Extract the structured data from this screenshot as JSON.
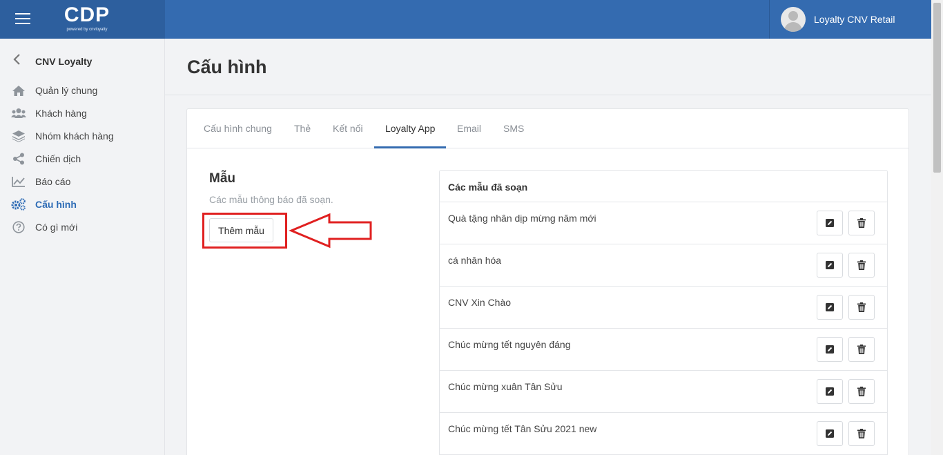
{
  "header": {
    "logo_text": "CDP",
    "logo_sub": "powered by cnvloyalty",
    "user_name": "Loyalty CNV Retail"
  },
  "sidebar": {
    "back_label": "CNV Loyalty",
    "items": [
      {
        "label": "Quản lý chung",
        "icon": "home-icon"
      },
      {
        "label": "Khách hàng",
        "icon": "users-icon"
      },
      {
        "label": "Nhóm khách hàng",
        "icon": "layers-icon"
      },
      {
        "label": "Chiến dịch",
        "icon": "share-icon"
      },
      {
        "label": "Báo cáo",
        "icon": "chart-line-icon"
      },
      {
        "label": "Cấu hình",
        "icon": "cogs-icon",
        "active": true
      },
      {
        "label": "Có gì mới",
        "icon": "question-circle-icon"
      }
    ]
  },
  "page": {
    "title": "Cấu hình"
  },
  "tabs": [
    {
      "label": "Cấu hình chung"
    },
    {
      "label": "Thẻ"
    },
    {
      "label": "Kết nối"
    },
    {
      "label": "Loyalty App",
      "active": true
    },
    {
      "label": "Email"
    },
    {
      "label": "SMS"
    }
  ],
  "section": {
    "title": "Mẫu",
    "description": "Các mẫu thông báo đã soạn.",
    "add_button": "Thêm mẫu"
  },
  "templates": {
    "header": "Các mẫu đã soạn",
    "rows": [
      {
        "name": "Quà tặng nhân dịp mừng năm mới"
      },
      {
        "name": "cá nhân hóa"
      },
      {
        "name": "CNV Xin Chào"
      },
      {
        "name": "Chúc mừng tết nguyên đáng"
      },
      {
        "name": "Chúc mừng xuân Tân Sửu"
      },
      {
        "name": "Chúc mừng tết Tân Sửu 2021 new"
      }
    ]
  },
  "colors": {
    "header_blue": "#346bb0",
    "brand_blue": "#2d5f9e",
    "active_blue": "#2d6bb5",
    "annotation_red": "#e02020"
  }
}
